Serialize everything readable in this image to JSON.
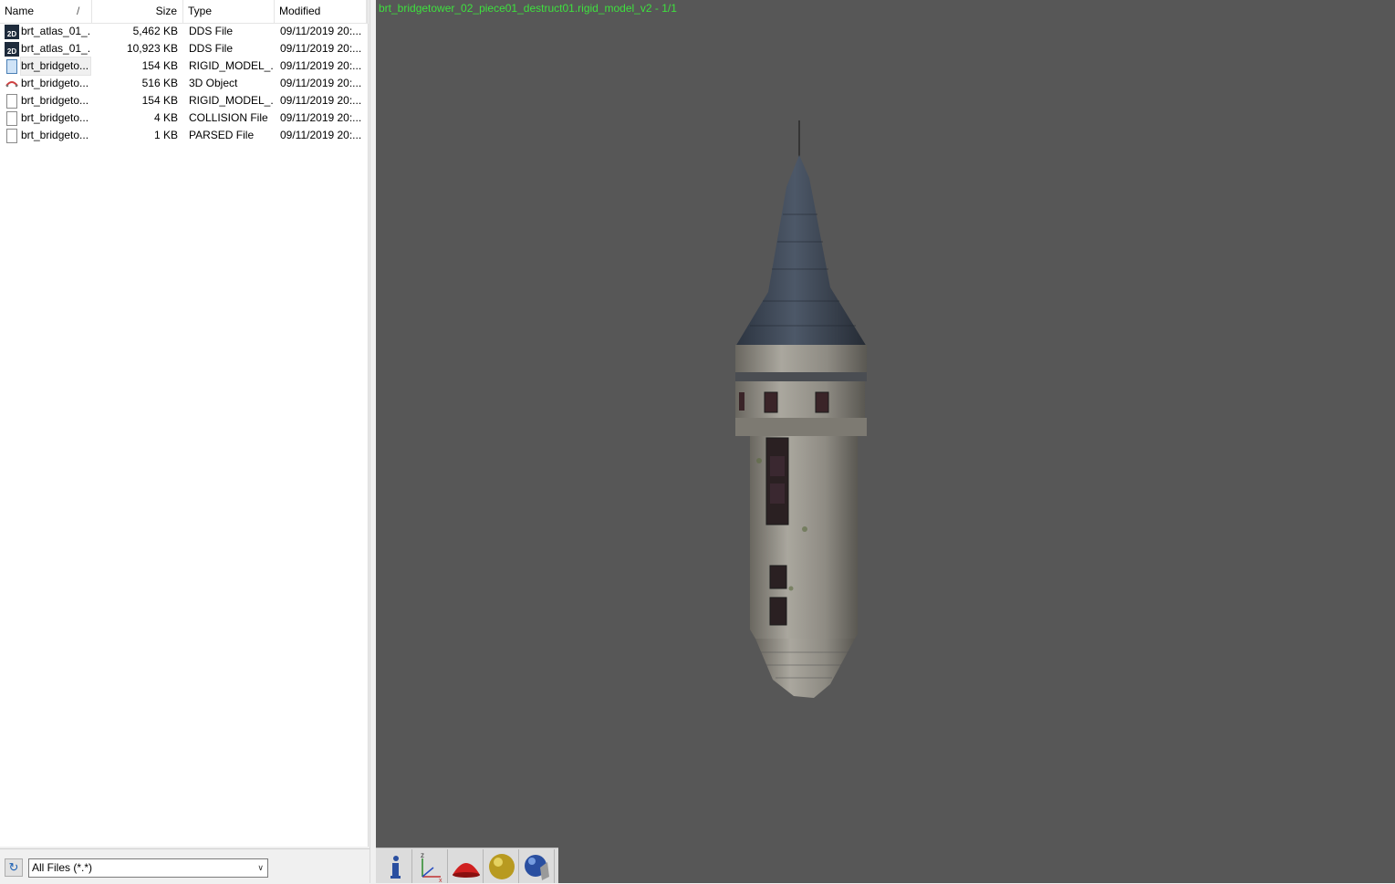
{
  "file_list": {
    "columns": {
      "name": "Name",
      "size": "Size",
      "type": "Type",
      "modified": "Modified"
    },
    "sort_indicator": "/",
    "rows": [
      {
        "icon": "dds-image-icon",
        "name": "brt_atlas_01_...",
        "size": "5,462 KB",
        "type": "DDS File",
        "modified": "09/11/2019 20:..."
      },
      {
        "icon": "dds-image-icon",
        "name": "brt_atlas_01_...",
        "size": "10,923 KB",
        "type": "DDS File",
        "modified": "09/11/2019 20:..."
      },
      {
        "icon": "rigid-model-file-icon",
        "name": "brt_bridgeto...",
        "size": "154 KB",
        "type": "RIGID_MODEL_...",
        "modified": "09/11/2019 20:...",
        "selected": true
      },
      {
        "icon": "3d-object-icon",
        "name": "brt_bridgeto...",
        "size": "516 KB",
        "type": "3D Object",
        "modified": "09/11/2019 20:..."
      },
      {
        "icon": "generic-file-icon",
        "name": "brt_bridgeto...",
        "size": "154 KB",
        "type": "RIGID_MODEL_...",
        "modified": "09/11/2019 20:..."
      },
      {
        "icon": "generic-file-icon",
        "name": "brt_bridgeto...",
        "size": "4 KB",
        "type": "COLLISION File",
        "modified": "09/11/2019 20:..."
      },
      {
        "icon": "generic-file-icon",
        "name": "brt_bridgeto...",
        "size": "1 KB",
        "type": "PARSED File",
        "modified": "09/11/2019 20:..."
      }
    ]
  },
  "dds_icon_text": "2D",
  "filter": {
    "selected": "All Files (*.*)"
  },
  "viewport": {
    "title": "brt_bridgetower_02_piece01_destruct01.rigid_model_v2 - 1/1",
    "background": "#575757",
    "title_color": "#3ee03e"
  },
  "toolbar": {
    "buttons": [
      "info-icon",
      "axes-icon",
      "red-dome-icon",
      "gold-sphere-icon",
      "blue-sphere-hand-icon"
    ],
    "axis_labels": {
      "z": "z",
      "x": "x"
    }
  }
}
